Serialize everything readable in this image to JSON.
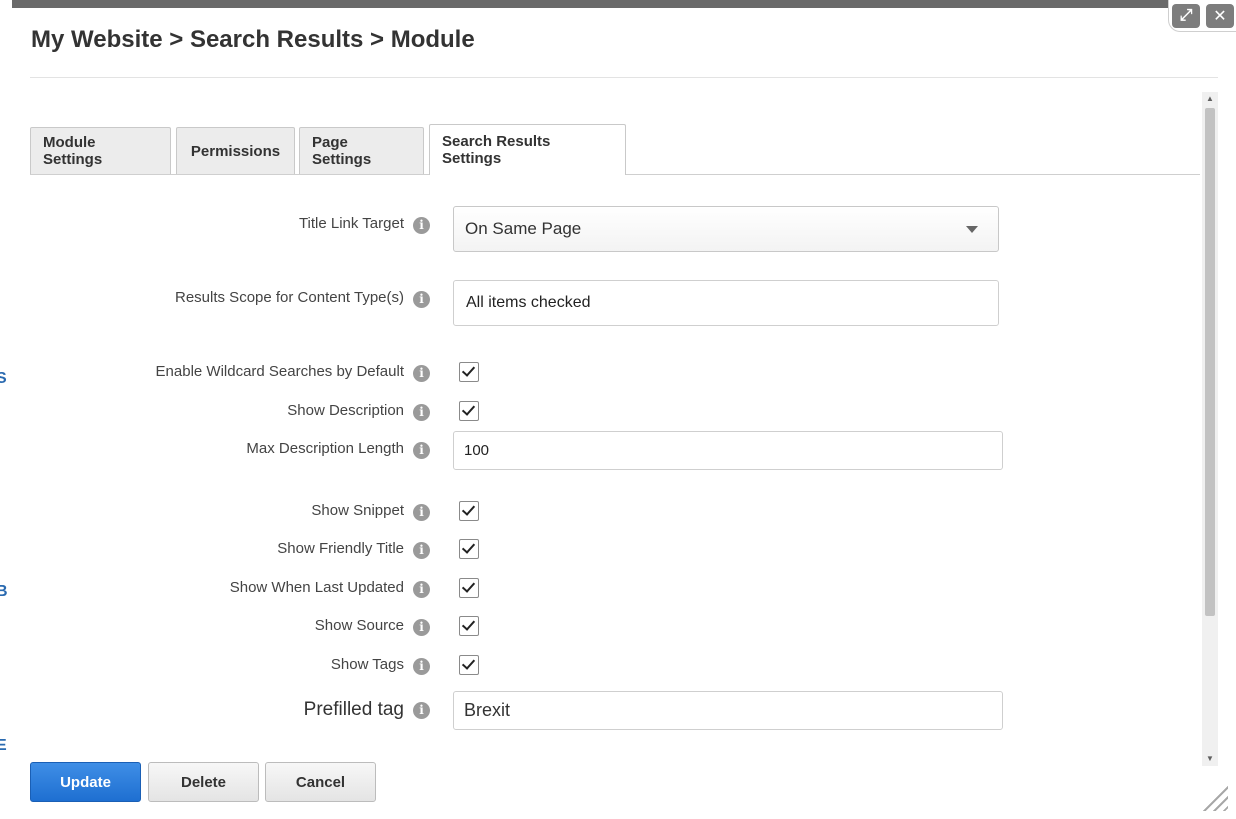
{
  "background": {
    "fragments": [
      "S",
      "B",
      "E"
    ]
  },
  "window": {
    "maximize_glyph": "⤢",
    "close_glyph": "✕"
  },
  "header": {
    "breadcrumb_title": "My Website > Search Results > Module"
  },
  "tabs": [
    {
      "label": "Module Settings",
      "active": false
    },
    {
      "label": "Permissions",
      "active": false
    },
    {
      "label": "Page Settings",
      "active": false
    },
    {
      "label": "Search Results Settings",
      "active": true
    }
  ],
  "form": {
    "title_link_target": {
      "label": "Title Link Target",
      "value": "On Same Page"
    },
    "results_scope": {
      "label": "Results Scope for Content Type(s)",
      "value": "All items checked"
    },
    "enable_wildcard": {
      "label": "Enable Wildcard Searches by Default",
      "checked": true
    },
    "show_description": {
      "label": "Show Description",
      "checked": true
    },
    "max_description_length": {
      "label": "Max Description Length",
      "value": "100"
    },
    "show_snippet": {
      "label": "Show Snippet",
      "checked": true
    },
    "show_friendly_title": {
      "label": "Show Friendly Title",
      "checked": true
    },
    "show_when_last_updated": {
      "label": "Show When Last Updated",
      "checked": true
    },
    "show_source": {
      "label": "Show Source",
      "checked": true
    },
    "show_tags": {
      "label": "Show Tags",
      "checked": true
    },
    "prefilled_tag": {
      "label": "Prefilled tag",
      "value": "Brexit"
    },
    "info_glyph": "i"
  },
  "footer": {
    "update_label": "Update",
    "delete_label": "Delete",
    "cancel_label": "Cancel"
  },
  "colors": {
    "primary_button": "#1e6fd1",
    "overlay": "#5a5a5a"
  }
}
